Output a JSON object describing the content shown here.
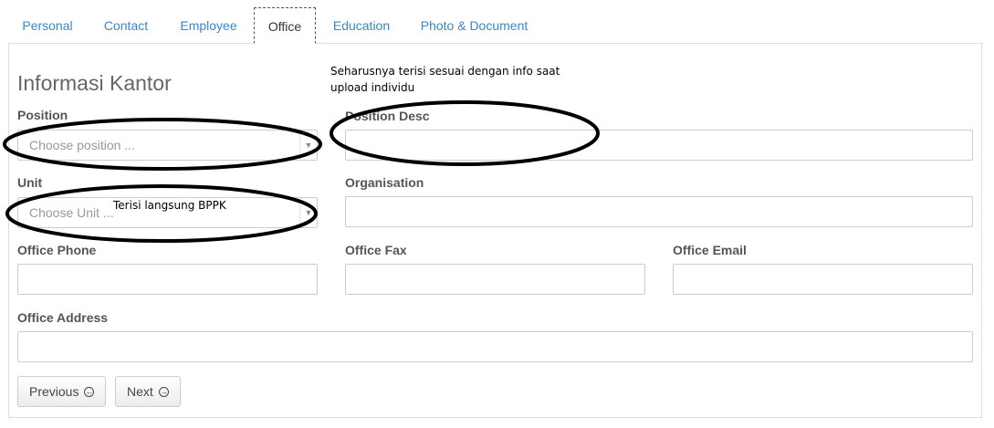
{
  "tabs": [
    "Personal",
    "Contact",
    "Employee",
    "Office",
    "Education",
    "Photo & Document"
  ],
  "active_tab": "Office",
  "heading": "Informasi Kantor",
  "annotations": {
    "position_desc_note_line1": "Seharusnya terisi sesuai dengan info saat",
    "position_desc_note_line2": "upload individu",
    "unit_note": "Terisi langsung BPPK"
  },
  "fields": {
    "position": {
      "label": "Position",
      "placeholder": "Choose position ..."
    },
    "position_desc": {
      "label": "Position Desc",
      "value": ""
    },
    "unit": {
      "label": "Unit",
      "placeholder": "Choose Unit ..."
    },
    "organisation": {
      "label": "Organisation",
      "value": ""
    },
    "office_phone": {
      "label": "Office Phone",
      "value": ""
    },
    "office_fax": {
      "label": "Office Fax",
      "value": ""
    },
    "office_email": {
      "label": "Office Email",
      "value": ""
    },
    "office_address": {
      "label": "Office Address",
      "value": ""
    }
  },
  "buttons": {
    "previous": "Previous",
    "next": "Next"
  },
  "icons": {
    "previous": "circle-arrow-left-icon",
    "next": "circle-arrow-right-icon",
    "caret": "caret-down-icon"
  },
  "colors": {
    "tab_link": "#3a87c7",
    "annotation_ink": "#000000"
  }
}
